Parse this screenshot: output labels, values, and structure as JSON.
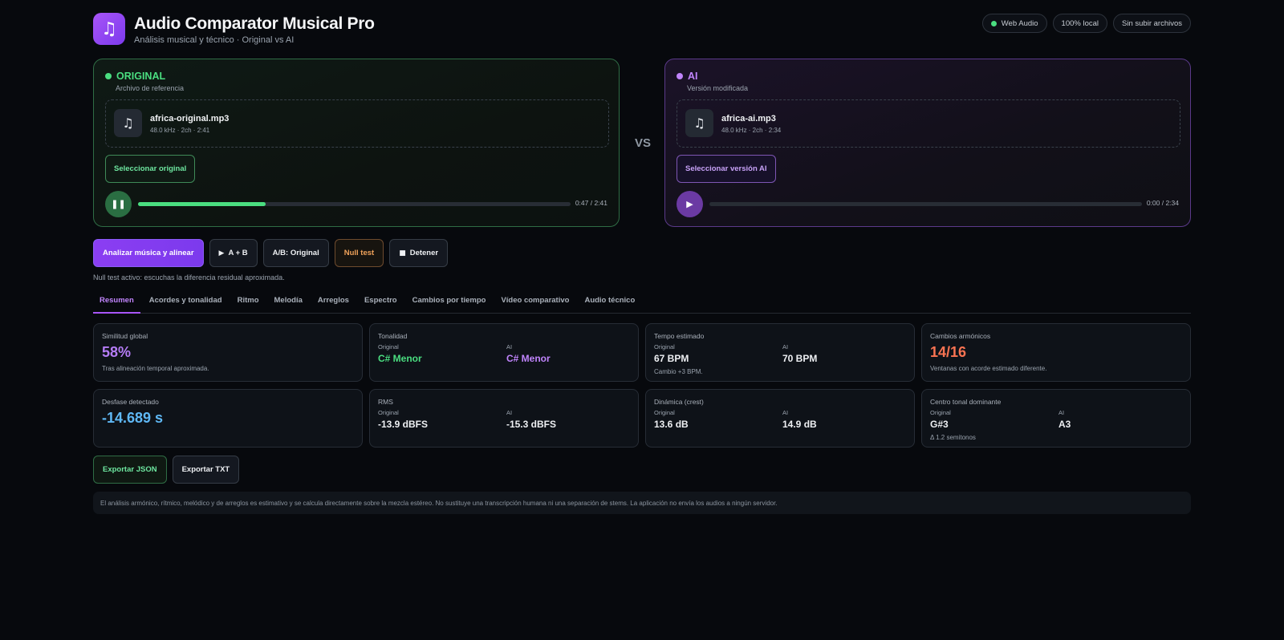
{
  "header": {
    "icon": "music-note-icon",
    "title": "Audio Comparator Musical Pro",
    "subtitle": "Análisis musical y técnico · Original vs AI",
    "badges": [
      "Web Audio",
      "100% local",
      "Sin subir archivos"
    ]
  },
  "original": {
    "title": "ORIGINAL",
    "description": "Archivo de referencia",
    "file_name": "africa-original.mp3",
    "file_meta": "48.0 kHz · 2ch · 2:41",
    "select_label": "Seleccionar original",
    "state": "playing",
    "progress": 0.295,
    "time": "0:47 / 2:41"
  },
  "vs_label": "VS",
  "ai": {
    "title": "AI",
    "description": "Versión modificada",
    "file_name": "africa-ai.mp3",
    "file_meta": "48.0 kHz · 2ch · 2:34",
    "select_label": "Seleccionar versión AI",
    "state": "paused",
    "progress": 0,
    "time": "0:00 / 2:34"
  },
  "actions": {
    "analyze": "Analizar música y alinear",
    "play_ab": "A + B",
    "ab_toggle": "A/B: Original",
    "null_test": "Null test",
    "stop": "Detener"
  },
  "null_note": "Null test activo: escuchas la diferencia residual aproximada.",
  "tabs": [
    "Resumen",
    "Acordes y tonalidad",
    "Ritmo",
    "Melodía",
    "Arreglos",
    "Espectro",
    "Cambios por tiempo",
    "Vídeo comparativo",
    "Audio técnico"
  ],
  "active_tab": "Resumen",
  "cards": {
    "similarity": {
      "label": "Similitud global",
      "value": "58%",
      "note": "Tras alineación temporal aproximada."
    },
    "key": {
      "label": "Tonalidad",
      "orig_head": "Original",
      "ai_head": "AI",
      "orig": "C# Menor",
      "ai": "C# Menor"
    },
    "tempo": {
      "label": "Tempo estimado",
      "orig_head": "Original",
      "ai_head": "AI",
      "orig": "67 BPM",
      "ai": "70 BPM",
      "note": "Cambio +3 BPM."
    },
    "harmonic": {
      "label": "Cambios armónicos",
      "value": "14/16",
      "note": "Ventanas con acorde estimado diferente."
    },
    "offset": {
      "label": "Desfase detectado",
      "value": "-14.689 s"
    },
    "rms": {
      "label": "RMS",
      "orig_head": "Original",
      "ai_head": "AI",
      "orig": "-13.9 dBFS",
      "ai": "-15.3 dBFS"
    },
    "dynamics": {
      "label": "Dinámica (crest)",
      "orig_head": "Original",
      "ai_head": "AI",
      "orig": "13.6 dB",
      "ai": "14.9 dB"
    },
    "tonal_center": {
      "label": "Centro tonal dominante",
      "orig_head": "Original",
      "ai_head": "AI",
      "orig": "G#3",
      "ai": "A3",
      "note": "Δ 1.2 semitonos"
    }
  },
  "exports": {
    "json": "Exportar JSON",
    "txt": "Exportar TXT"
  },
  "footer_note": "El análisis armónico, rítmico, melódico y de arreglos es estimativo y se calcula directamente sobre la mezcla estéreo. No sustituye una transcripción humana ni una separación de stems. La aplicación no envía los audios a ningún servidor."
}
